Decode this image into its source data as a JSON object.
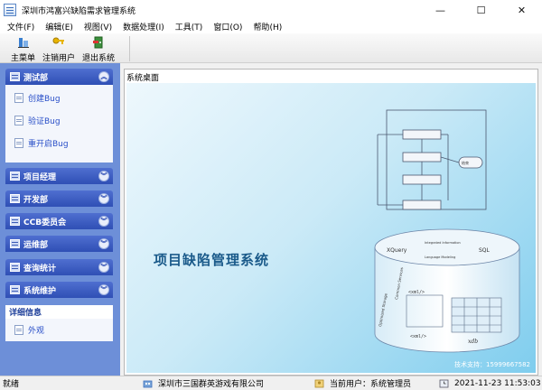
{
  "window": {
    "title": "深圳市鸿富兴缺陷需求管理系统",
    "minimize": "—",
    "maximize": "☐",
    "close": "✕"
  },
  "menu": [
    {
      "label": "文件(F)"
    },
    {
      "label": "编辑(E)"
    },
    {
      "label": "视图(V)"
    },
    {
      "label": "数据处理(I)"
    },
    {
      "label": "工具(T)"
    },
    {
      "label": "窗口(O)"
    },
    {
      "label": "帮助(H)"
    }
  ],
  "toolbar": {
    "main_menu": "主菜单",
    "logout": "注销用户",
    "exit": "退出系统"
  },
  "sidebar": {
    "groups": [
      {
        "label": "测试部",
        "items": [
          "创建Bug",
          "验证Bug",
          "重开启Bug"
        ]
      },
      {
        "label": "项目经理"
      },
      {
        "label": "开发部"
      },
      {
        "label": "CCB委员会"
      },
      {
        "label": "运维部"
      },
      {
        "label": "查询统计"
      },
      {
        "label": "系统维护"
      }
    ],
    "detail": {
      "title": "详细信息",
      "item": "外观"
    }
  },
  "main": {
    "tab_title": "系统桌面",
    "system_title": "项目缺陷管理系统",
    "diagram_labels": [
      "XQuery",
      "SQL",
      "Integrated Information",
      "Language Modeling",
      "Optimized Storage",
      "Common Services",
      "<xml/>",
      "xdb",
      "结束"
    ],
    "support_phone": "技术支持：15999667582"
  },
  "status": {
    "ready": "就绪",
    "company": "深圳市三国群英游戏有限公司",
    "user": "当前用户：系统管理员",
    "datetime": "2021-11-23 11:53:03"
  },
  "colors": {
    "nav_header": "#2f4fb5",
    "sidebar_bg": "#6d8fd8",
    "link": "#2a50c8",
    "desk_title": "#1a5a8a"
  }
}
